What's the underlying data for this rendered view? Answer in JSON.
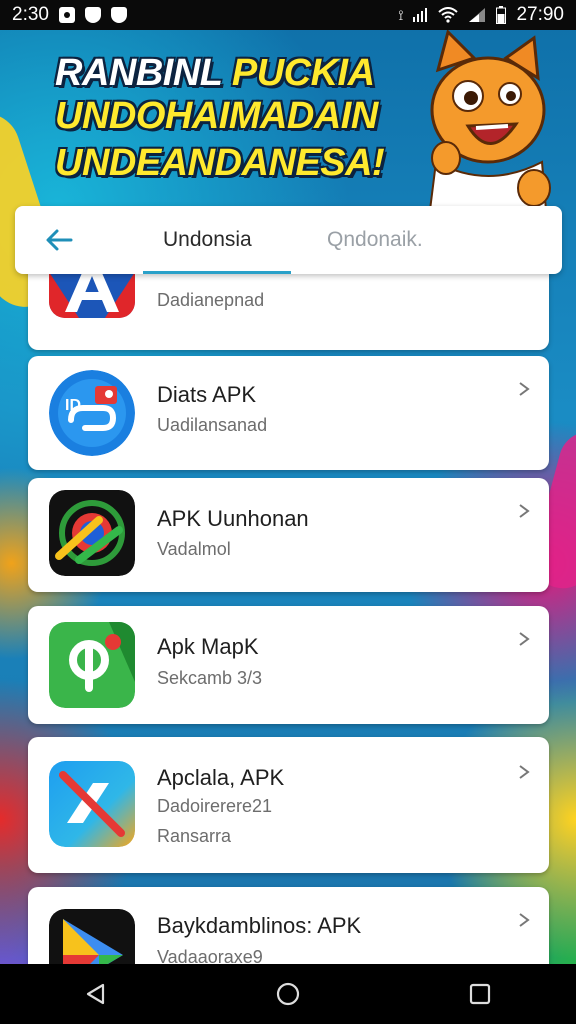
{
  "status_bar": {
    "time_left": "2:30",
    "time_right": "27:90",
    "icons": [
      "notification-icon",
      "shield-icon",
      "shield-icon",
      "vibrate-icon",
      "signal-icon",
      "wifi-icon",
      "signal-icon",
      "battery-icon"
    ]
  },
  "banner": {
    "line1_white": "RANBINL",
    "line1_yellow": "PUCKIA",
    "line2": "UNDOHAIMADAIN",
    "line3": "UNDEANDANESA!"
  },
  "tabs": [
    {
      "label": "Undonsia",
      "active": true
    },
    {
      "label": "Qndonaik.",
      "active": false
    }
  ],
  "apps": [
    {
      "name": "",
      "subtitle": "Dadianepnad",
      "subtitle2": "",
      "icon": "a-letter-icon"
    },
    {
      "name": "Diats APK",
      "subtitle": "Uadilansanad",
      "subtitle2": "",
      "icon": "link-badge-icon"
    },
    {
      "name": "APK Uunhonan",
      "subtitle": "Vadalmol",
      "subtitle2": "",
      "icon": "target-icon"
    },
    {
      "name": "Apk MapK",
      "subtitle": "Sekcamb 3/3",
      "subtitle2": "",
      "icon": "p-letter-icon"
    },
    {
      "name": "Apclala, APK",
      "subtitle": "Dadoirerere21",
      "subtitle2": "Ransarra",
      "icon": "slash-icon"
    },
    {
      "name": "Baykdamblinos: APK",
      "subtitle": "Vadaaoraxe9",
      "subtitle2": "",
      "icon": "play-icon"
    }
  ],
  "colors": {
    "accent": "#2aa1c9",
    "banner_yellow": "#ffe92e",
    "banner_outline": "#0c2340"
  }
}
